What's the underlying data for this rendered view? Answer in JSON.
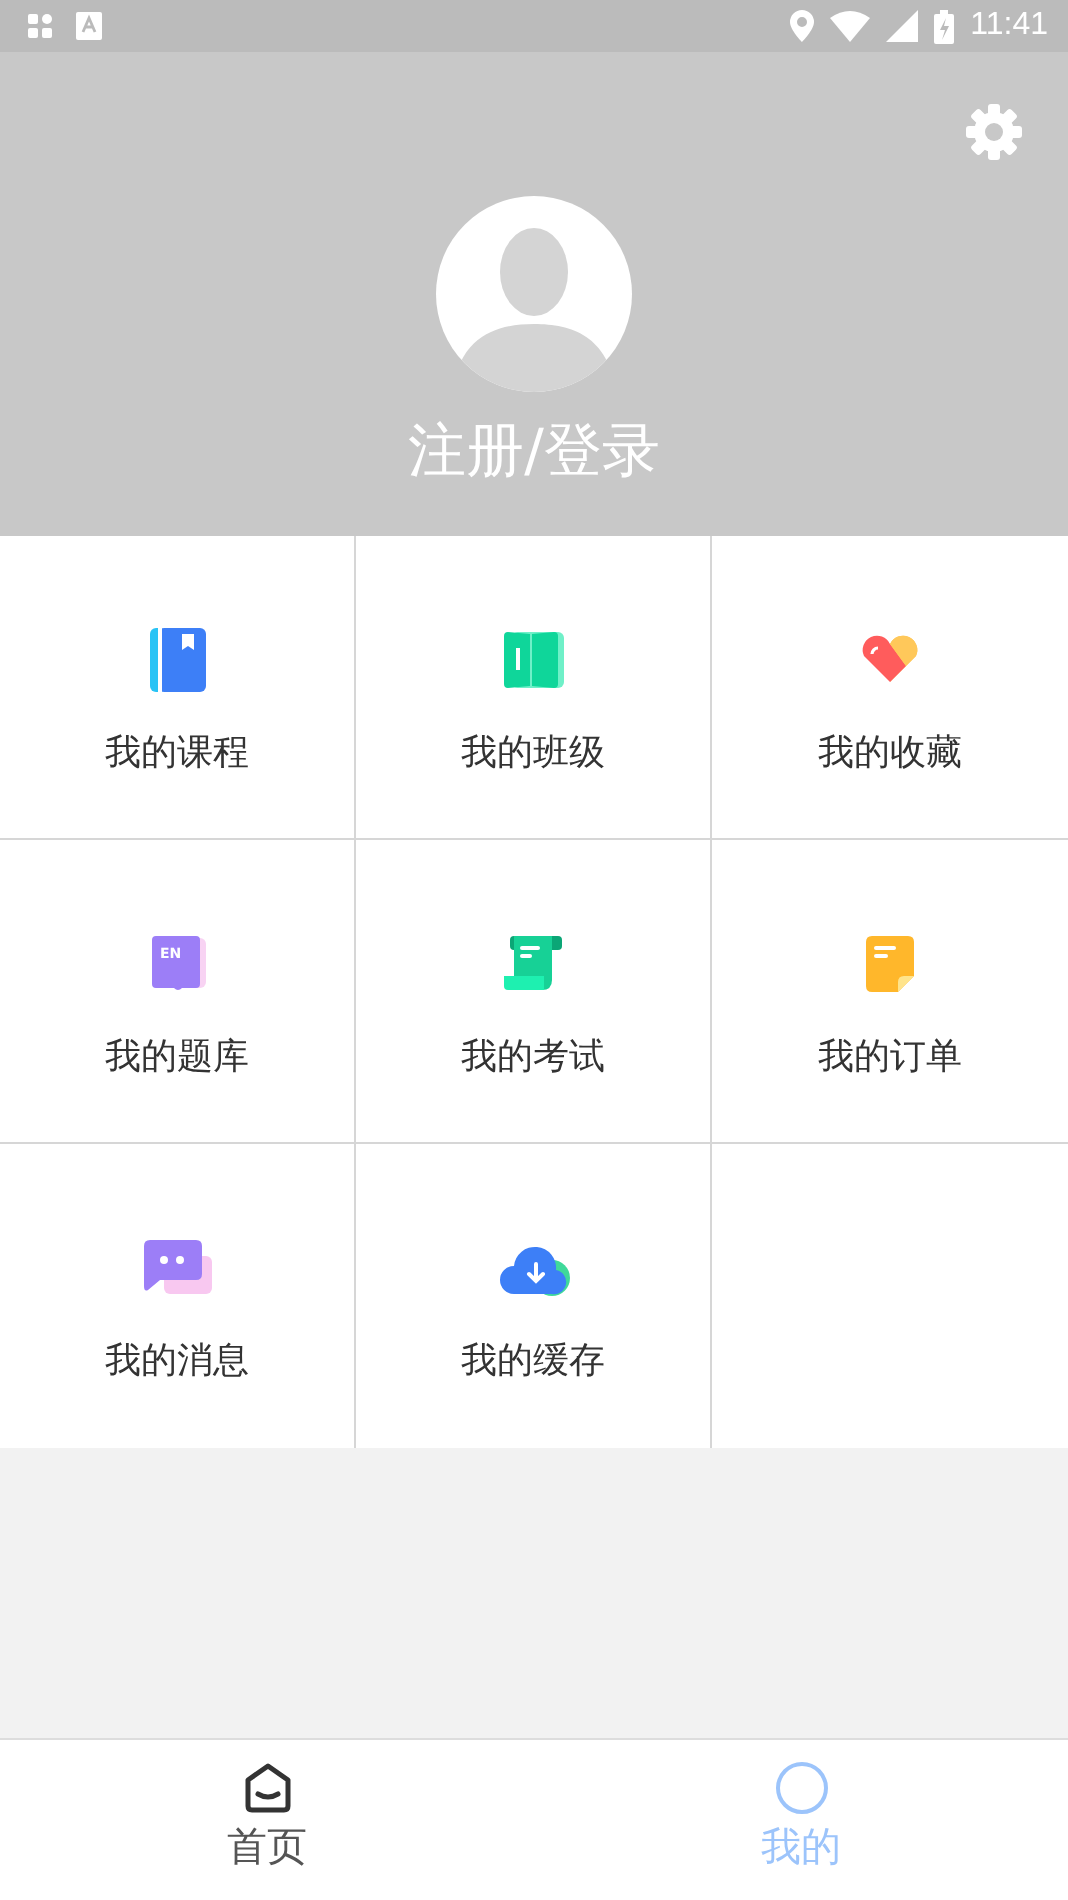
{
  "status_bar": {
    "time": "11:41"
  },
  "profile": {
    "login_label": "注册/登录"
  },
  "menu": [
    {
      "label": "我的课程",
      "kind": "book"
    },
    {
      "label": "我的班级",
      "kind": "map"
    },
    {
      "label": "我的收藏",
      "kind": "heart"
    },
    {
      "label": "我的题库",
      "kind": "en",
      "badge": "EN"
    },
    {
      "label": "我的考试",
      "kind": "scroll"
    },
    {
      "label": "我的订单",
      "kind": "note"
    },
    {
      "label": "我的消息",
      "kind": "chat"
    },
    {
      "label": "我的缓存",
      "kind": "cloud"
    }
  ],
  "tab_bar": [
    {
      "label": "首页",
      "kind": "home",
      "selected": false
    },
    {
      "label": "我的",
      "kind": "person",
      "selected": true
    }
  ]
}
